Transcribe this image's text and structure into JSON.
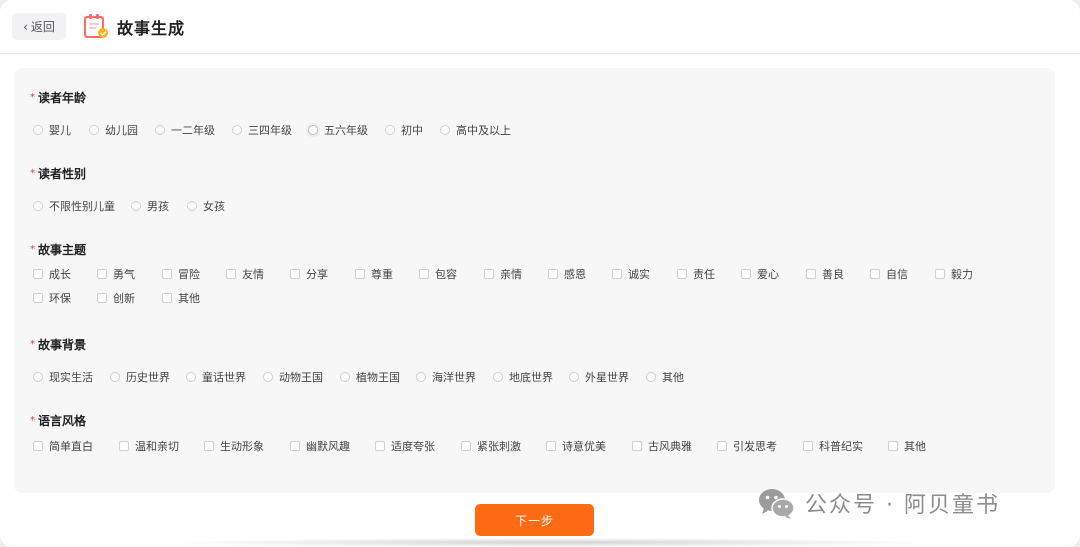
{
  "header": {
    "back_label": "返回",
    "title": "故事生成"
  },
  "sections": {
    "age": {
      "title": "读者年龄",
      "options": [
        "婴儿",
        "幼儿园",
        "一二年级",
        "三四年级",
        "五六年级",
        "初中",
        "高中及以上"
      ]
    },
    "gender": {
      "title": "读者性别",
      "options": [
        "不限性别儿童",
        "男孩",
        "女孩"
      ]
    },
    "theme": {
      "title": "故事主题",
      "options": [
        "成长",
        "勇气",
        "冒险",
        "友情",
        "分享",
        "尊重",
        "包容",
        "亲情",
        "感恩",
        "诚实",
        "责任",
        "爱心",
        "善良",
        "自信",
        "毅力",
        "环保",
        "创新",
        "其他"
      ]
    },
    "background": {
      "title": "故事背景",
      "options": [
        "现实生活",
        "历史世界",
        "童话世界",
        "动物王国",
        "植物王国",
        "海洋世界",
        "地底世界",
        "外星世界",
        "其他"
      ]
    },
    "style": {
      "title": "语言风格",
      "options": [
        "简单直白",
        "温和亲切",
        "生动形象",
        "幽默风趣",
        "适度夸张",
        "紧张刺激",
        "诗意优美",
        "古风典雅",
        "引发思考",
        "科普纪实",
        "其他"
      ]
    }
  },
  "footer": {
    "next_label": "下一步"
  },
  "watermark": {
    "text": "公众号 · 阿贝童书"
  },
  "colors": {
    "accent": "#ff6b14",
    "required_star": "#e53935",
    "panel_bg": "#f7f7f8"
  }
}
